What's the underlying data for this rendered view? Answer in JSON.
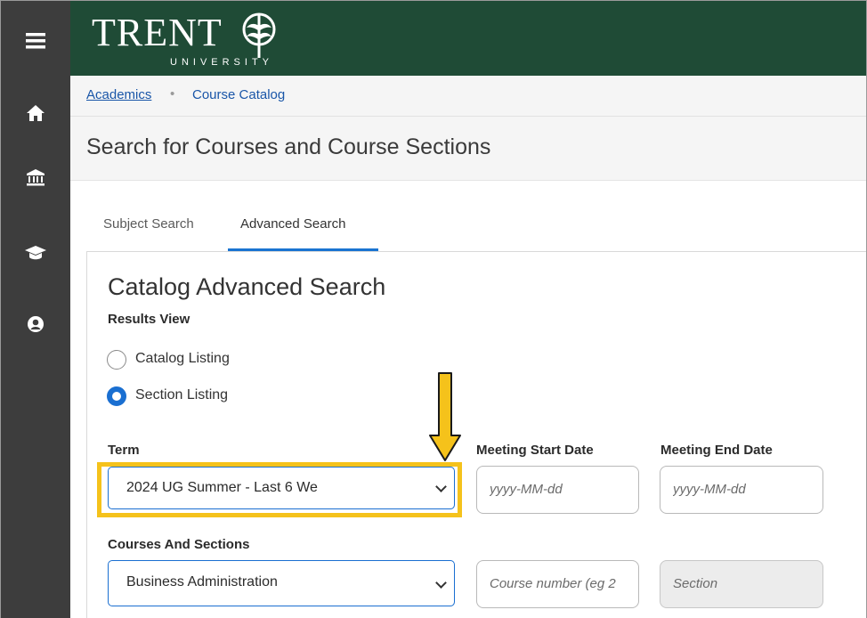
{
  "header": {
    "logo_word": "TRENT",
    "logo_sub": "UNIVERSITY"
  },
  "rail": {
    "icons": [
      "menu-icon",
      "home-icon",
      "institution-icon",
      "graduation-cap-icon",
      "user-circle-icon"
    ]
  },
  "breadcrumb": {
    "item1": "Academics",
    "separator": "•",
    "item2": "Course Catalog"
  },
  "page_title": "Search for Courses and Course Sections",
  "tabs": [
    {
      "label": "Subject Search"
    },
    {
      "label": "Advanced Search"
    }
  ],
  "form": {
    "heading": "Catalog Advanced Search",
    "results_view_label": "Results View",
    "radio_catalog": "Catalog Listing",
    "radio_section": "Section Listing",
    "term_label": "Term",
    "term_value": "2024 UG Summer - Last 6 We",
    "start_date_label": "Meeting Start Date",
    "start_date_placeholder": "yyyy-MM-dd",
    "end_date_label": "Meeting End Date",
    "end_date_placeholder": "yyyy-MM-dd",
    "courses_label": "Courses And Sections",
    "subject_value": "Business Administration",
    "course_number_placeholder": "Course number (eg 2",
    "section_placeholder": "Section"
  },
  "colors": {
    "header": "#1f4b36",
    "rail": "#3d3d3d",
    "accent": "#1a6fd1",
    "highlight": "#f5c21b"
  }
}
